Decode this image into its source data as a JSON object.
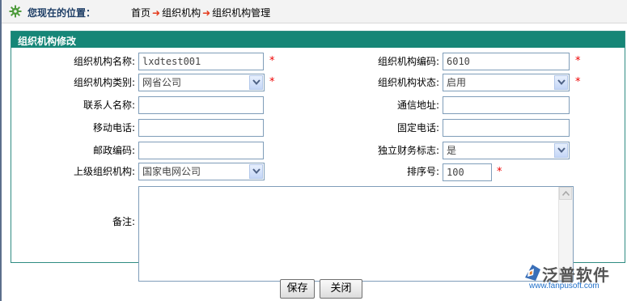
{
  "breadcrumb": {
    "label": "您现在的位置：",
    "items": [
      "首页",
      "组织机构",
      "组织机构管理"
    ]
  },
  "panel": {
    "title": "组织机构修改"
  },
  "form": {
    "org_name": {
      "label": "组织机构名称:",
      "value": "lxdtest001",
      "required": "*"
    },
    "org_code": {
      "label": "组织机构编码:",
      "value": "6010",
      "required": "*"
    },
    "org_type": {
      "label": "组织机构类别:",
      "value": "网省公司",
      "required": "*"
    },
    "org_status": {
      "label": "组织机构状态:",
      "value": "启用",
      "required": "*"
    },
    "contact_name": {
      "label": "联系人名称:",
      "value": ""
    },
    "address": {
      "label": "通信地址:",
      "value": ""
    },
    "mobile": {
      "label": "移动电话:",
      "value": ""
    },
    "phone": {
      "label": "固定电话:",
      "value": ""
    },
    "postcode": {
      "label": "邮政编码:",
      "value": ""
    },
    "independent_finance": {
      "label": "独立财务标志:",
      "value": "是"
    },
    "parent_org": {
      "label": "上级组织机构:",
      "value": "国家电网公司"
    },
    "sort_no": {
      "label": "排序号:",
      "value": "100",
      "required": "*"
    },
    "remark": {
      "label": "备注:",
      "value": ""
    }
  },
  "buttons": {
    "save": "保存",
    "close": "关闭"
  },
  "logo": {
    "name": "泛普软件",
    "url": "www.fanpusoft.com"
  },
  "colors": {
    "header_bg": "#168677",
    "required": "#ee0000",
    "arrow": "#e53b1c",
    "input_border": "#7f9db9"
  }
}
